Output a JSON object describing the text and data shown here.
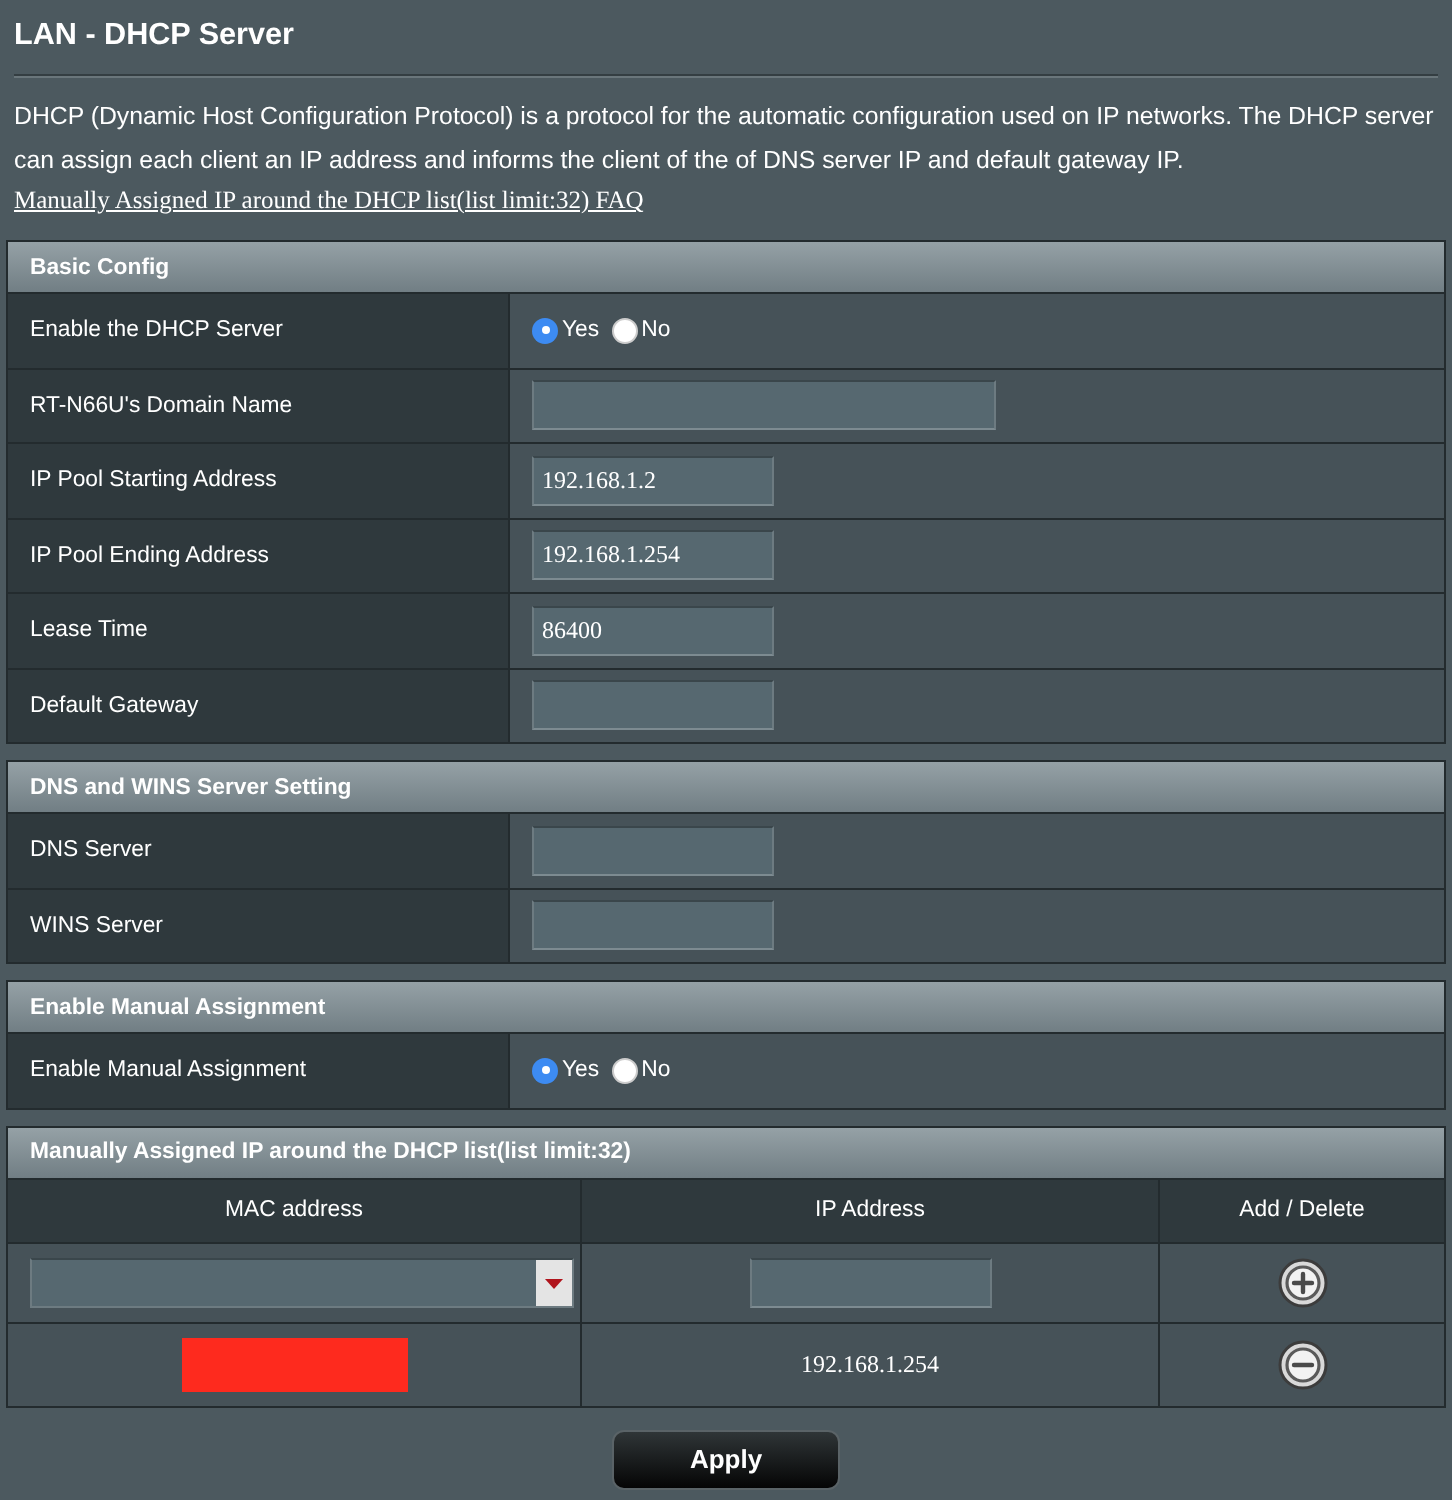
{
  "page": {
    "title": "LAN - DHCP Server",
    "description": "DHCP (Dynamic Host Configuration Protocol) is a protocol for the automatic configuration used on IP networks. The DHCP server can assign each client an IP address and informs the client of the of DNS server IP and default gateway IP.",
    "faq_link": "Manually Assigned IP around the DHCP list(list limit:32) FAQ"
  },
  "sections": [
    {
      "kind": "form",
      "title": "Basic Config",
      "rows": [
        {
          "label": "Enable the DHCP Server",
          "kind": "radio",
          "options": [
            {
              "label": "Yes",
              "selected": true
            },
            {
              "label": "No",
              "selected": false
            }
          ]
        },
        {
          "label": "RT-N66U's Domain Name",
          "kind": "widefield"
        },
        {
          "label": "IP Pool Starting Address",
          "kind": "field",
          "value": "192.168.1.2"
        },
        {
          "label": "IP Pool Ending Address",
          "kind": "field",
          "value": "192.168.1.254"
        },
        {
          "label": "Lease Time",
          "kind": "field",
          "value": "86400"
        },
        {
          "label": "Default Gateway",
          "kind": "field"
        }
      ]
    },
    {
      "kind": "form",
      "title": "DNS and WINS Server Setting",
      "rows": [
        {
          "label": "DNS Server",
          "kind": "field"
        },
        {
          "label": "WINS Server",
          "kind": "field"
        }
      ]
    },
    {
      "kind": "form",
      "title": "Enable Manual Assignment",
      "rows": [
        {
          "label": "Enable Manual Assignment",
          "kind": "radio",
          "options": [
            {
              "label": "Yes",
              "selected": true
            },
            {
              "label": "No",
              "selected": false
            }
          ]
        }
      ]
    },
    {
      "kind": "table",
      "title": "Manually Assigned IP around the DHCP list(list limit:32)",
      "columns": [
        "MAC address",
        "IP Address",
        "Add / Delete"
      ],
      "rows": [
        {
          "kind": "entry"
        },
        {
          "kind": "item",
          "mac_redacted": true,
          "ip": "192.168.1.254"
        }
      ]
    }
  ],
  "apply_button": "Apply"
}
